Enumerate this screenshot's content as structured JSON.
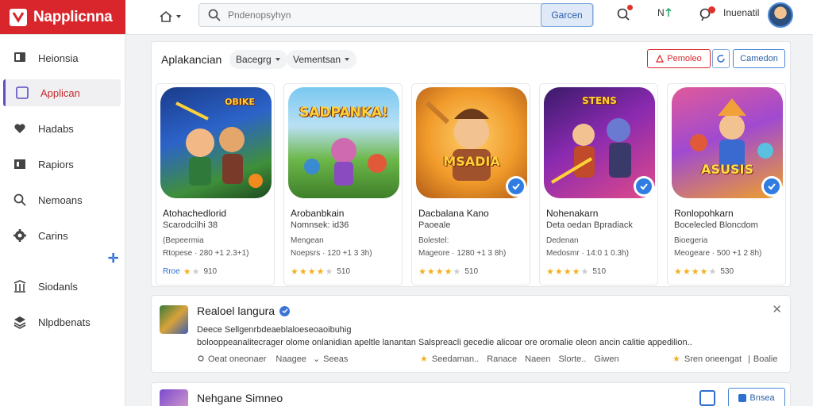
{
  "header": {
    "logo_text": "Napplicnna",
    "search_placeholder": "Pndenopsyhyn",
    "search_button": "Garcen",
    "nav_short": "N",
    "user_label": "Inuenatil"
  },
  "sidebar": {
    "items": [
      {
        "label": "Heionsia",
        "icon": "monitor-icon"
      },
      {
        "label": "Applican",
        "icon": "app-icon",
        "active": true
      },
      {
        "label": "Hadabs",
        "icon": "heart-icon"
      },
      {
        "label": "Rapiors",
        "icon": "report-icon"
      },
      {
        "label": "Nemoans",
        "icon": "search-icon"
      },
      {
        "label": "Carins",
        "icon": "gear-icon"
      },
      {
        "label": "Siodanls",
        "icon": "library-icon"
      },
      {
        "label": "Nlpdbenats",
        "icon": "stack-icon"
      }
    ]
  },
  "panel": {
    "title": "Aplakancian",
    "filter1": "Bacegrg",
    "filter2": "Vementsan",
    "btn_primary": "Pemoleo",
    "btn_secondary": "Camedon"
  },
  "cards": [
    {
      "art_text": "OBIKE",
      "title": "Atohachedlorid",
      "subtitle": "Scarodcilhi 38",
      "line3": "(Bepeermia",
      "line4": "Rtopese · 280 +1 2.3+1)",
      "price": "Rroe",
      "rating": 1,
      "count": "910",
      "verified": false
    },
    {
      "art_text": "SADPANKA!",
      "title": "Arobanbkain",
      "subtitle": "Nomnsek: id36",
      "line3": "Mengean",
      "line4": "Noepsrs · 120 +1 3 3h)",
      "price": "",
      "rating": 4,
      "count": "510",
      "verified": false
    },
    {
      "art_text": "MSADIA",
      "title": "Dacbalana Kano",
      "subtitle": "Paoeale",
      "line3": "Bolestel:",
      "line4": "Mageore · 1280 +1 3 8h)",
      "price": "",
      "rating": 4,
      "count": "510",
      "verified": true
    },
    {
      "art_text": "STENS",
      "title": "Nohenakarn",
      "subtitle": "Deta oedan Bpradiack",
      "line3": "Dedenan",
      "line4": "Medosmr · 14:0 1 0.3h)",
      "price": "",
      "rating": 4,
      "count": "510",
      "verified": true
    },
    {
      "art_text": "ASUSIS",
      "title": "Ronlopohkarn",
      "subtitle": "Bocelecled Bloncdom",
      "line3": "Bioegeria",
      "line4": "Meogeare · 500 +1 2 8h)",
      "price": "",
      "rating": 4,
      "count": "530",
      "verified": true
    }
  ],
  "feature": {
    "title": "Realoel langura",
    "line1": "Deece Sellgenrbdeaeblaloeseoaoibuhig",
    "line2": "bolooppeanalitecrager olome onlanidian apeltle lanantan Salspreacli gecedie alicoar ore oromalie oleon ancin calitie appedilion..",
    "meta1": "Oeat oneonaer",
    "meta2": "Naagee",
    "meta3": "Seeas",
    "meta4": "Seedaman..",
    "meta5": "Ranace",
    "meta6": "Naeen",
    "meta7": "Slorte..",
    "meta8": "Giwen",
    "meta9": "Sren oneengat",
    "meta10": "Boalie"
  },
  "bottom": {
    "title": "Nehgane Simneo",
    "button": "Bnsea"
  },
  "colors": {
    "brand": "#d9262c",
    "accent": "#2f6fd0",
    "active": "#5b4fc2"
  }
}
